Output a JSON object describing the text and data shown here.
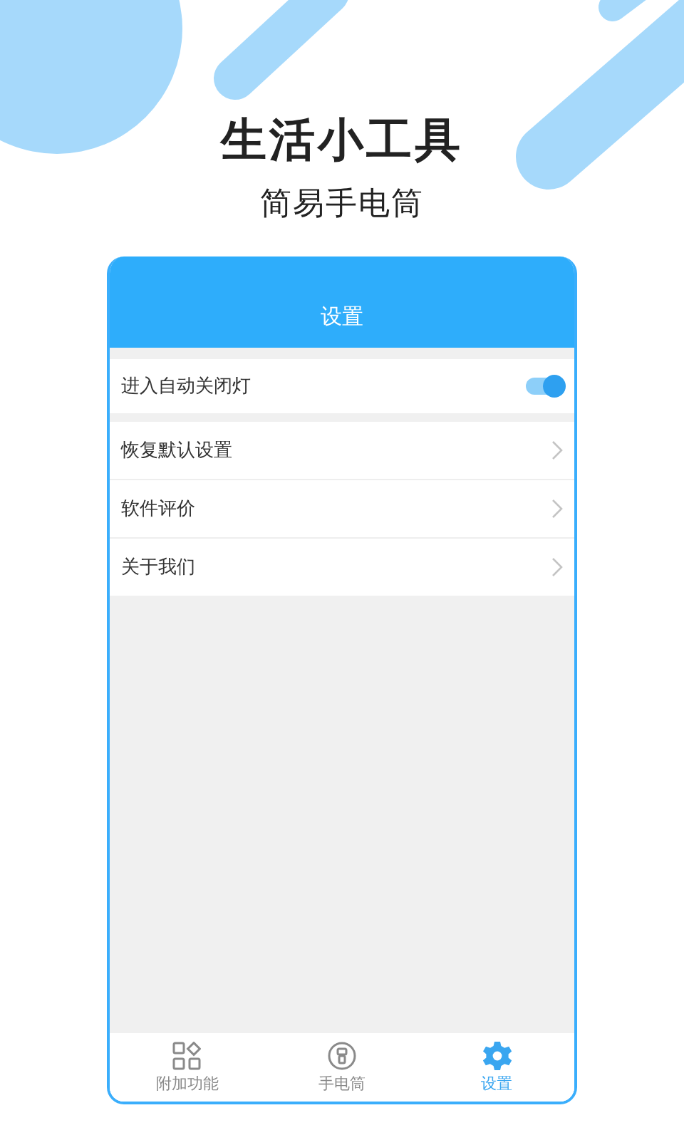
{
  "headline": "生活小工具",
  "subtitle": "简易手电筒",
  "phone": {
    "title": "设置",
    "toggle_row": {
      "label": "进入自动关闭灯",
      "on": true
    },
    "menu_items": [
      {
        "label": "恢复默认设置"
      },
      {
        "label": "软件评价"
      },
      {
        "label": "关于我们"
      }
    ],
    "tabs": [
      {
        "label": "附加功能",
        "kind": "grid",
        "selected": false
      },
      {
        "label": "手电筒",
        "kind": "flashlight",
        "selected": false
      },
      {
        "label": "设置",
        "kind": "gear",
        "selected": true
      }
    ]
  }
}
